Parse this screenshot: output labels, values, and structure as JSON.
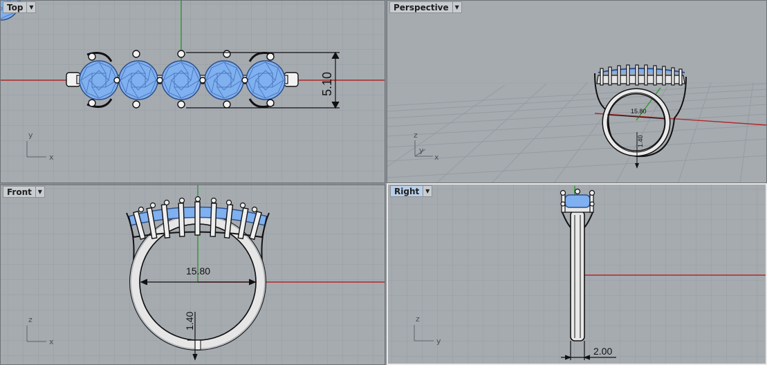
{
  "viewports": {
    "top": {
      "label": "Top",
      "dim_height": "5.10",
      "axis_a": "y",
      "axis_b": "x"
    },
    "persp": {
      "label": "Perspective",
      "dim_diameter": "15.80",
      "dim_thickness": "1.40",
      "axis_a": "z",
      "axis_b": "y",
      "axis_c": "x"
    },
    "front": {
      "label": "Front",
      "dim_diameter": "15.80",
      "dim_thickness": "1.40",
      "axis_a": "z",
      "axis_b": "x"
    },
    "right": {
      "label": "Right",
      "dim_width": "2.00",
      "axis_a": "z",
      "axis_b": "y"
    }
  },
  "active_viewport": "Right",
  "icons": {
    "dropdown": "chevron-down-icon"
  },
  "colors": {
    "viewport_bg": "#a6abb0",
    "grid": "#9096a0",
    "x_axis": "#b02828",
    "y_axis": "#2a9a2a",
    "gem": "#7fb0f0",
    "metal": "#e6e6e6"
  }
}
